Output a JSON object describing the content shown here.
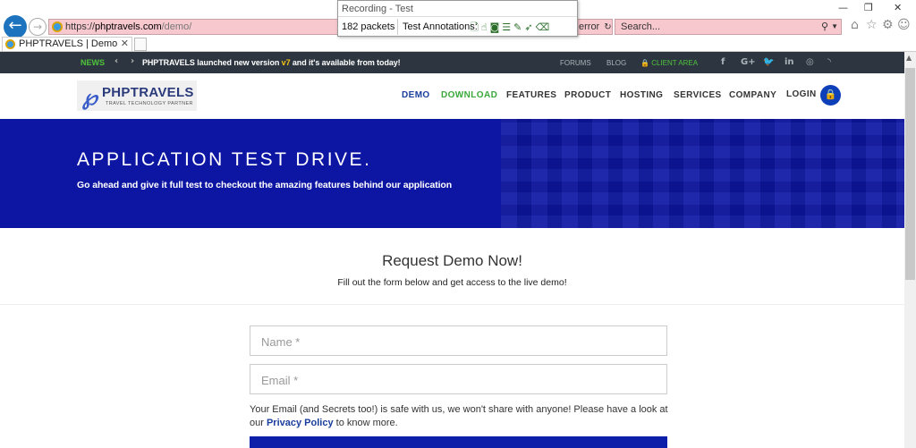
{
  "browser": {
    "url_prefix": "https://",
    "url_domain": "phptravels.com",
    "url_path": "/demo/",
    "address_overflow": "error",
    "search_placeholder": "Search...",
    "tab_title": "PHPTRAVELS | Demo"
  },
  "recorder": {
    "title": "Recording - Test",
    "packets": "182 packets",
    "annotations_label": "Test Annotations:"
  },
  "topbar": {
    "news_label": "NEWS",
    "message_start": "PHPTRAVELS launched new version ",
    "message_version": "v7",
    "message_end": " and it's available from today!",
    "forums": "FORUMS",
    "blog": "BLOG",
    "client_area": "CLIENT AREA"
  },
  "logo": {
    "name": "PHPTRAVELS",
    "tagline": "TRAVEL TECHNOLOGY PARTNER"
  },
  "menu": {
    "demo": "DEMO",
    "download": "DOWNLOAD",
    "features": "FEATURES",
    "product": "PRODUCT",
    "hosting": "HOSTING",
    "services": "SERVICES",
    "company": "COMPANY",
    "login": "LOGIN"
  },
  "hero": {
    "title": "APPLICATION TEST DRIVE.",
    "subtitle": "Go ahead and give it full test to checkout the amazing features behind our application"
  },
  "form": {
    "title": "Request Demo Now!",
    "subtitle": "Fill out the form below and get access to the live demo!",
    "name_placeholder": "Name *",
    "email_placeholder": "Email *",
    "privacy_text": "Your Email (and Secrets too!) is safe with us, we won't share with anyone! Please have a look at our ",
    "privacy_link": "Privacy Policy",
    "privacy_end": " to know more."
  },
  "colors": {
    "brand_blue": "#0d16a3",
    "accent_green": "#4fc43a",
    "topbar_bg": "#2d3640"
  }
}
